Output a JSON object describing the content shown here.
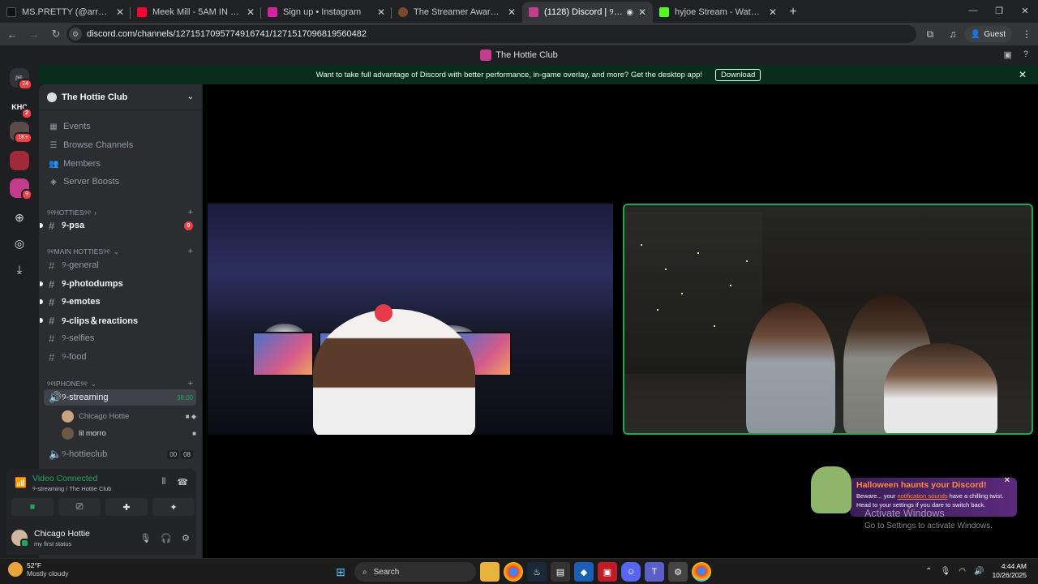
{
  "browser": {
    "tabs": [
      {
        "title": "MS.PRETTY (@arrogantdoll) | T",
        "color": "#111111",
        "active": false
      },
      {
        "title": "Meek Mill - 5AM IN PHILLY (Of",
        "color": "#ff0033",
        "active": false
      },
      {
        "title": "Sign up • Instagram",
        "color": "#d6249f",
        "active": false
      },
      {
        "title": "The Streamer Awards - Nomina",
        "color": "#7a4a2c",
        "active": false
      },
      {
        "title": "(1128) Discord | ୨-streamin",
        "color": "#c43d8c",
        "active": true
      },
      {
        "title": "hyjoe Stream - Watch Live on K",
        "color": "#53fc18",
        "active": false
      }
    ],
    "url": "discord.com/channels/1271517095774916741/1271517096819560482",
    "profile_label": "Guest"
  },
  "discord": {
    "window_title": "The Hottie Club",
    "server_badges": [
      "24",
      "2",
      "1K+",
      "9"
    ],
    "server_initials": "KHC",
    "banner": {
      "text": "Want to take full advantage of Discord with better performance, in-game overlay, and more? Get the desktop app!",
      "download_label": "Download"
    },
    "server_name": "The Hottie Club",
    "nav": [
      {
        "label": "Events"
      },
      {
        "label": "Browse Channels"
      },
      {
        "label": "Members"
      },
      {
        "label": "Server Boosts"
      }
    ],
    "categories": [
      "୨୧HOTTIES୨୧",
      "୨୧MAIN HOTTIES୨୧",
      "୨୧IPHONE୨୧"
    ],
    "channels_1": [
      {
        "name": "୨-psa",
        "badge": "9"
      }
    ],
    "channels_2": [
      {
        "name": "୨-general"
      },
      {
        "name": "୨-photodumps"
      },
      {
        "name": "୨-emotes"
      },
      {
        "name": "୨-clips＆reactions"
      },
      {
        "name": "୨-selfies"
      },
      {
        "name": "୨-food"
      }
    ],
    "voice_channel": {
      "name": "୨-streaming",
      "timer": "38:00"
    },
    "voice_users": [
      {
        "name": "Chicago Hottie"
      },
      {
        "name": "lil morro"
      }
    ],
    "voice_channel_2": {
      "name": "୨-hottieclub",
      "count_a": "00",
      "count_b": "08"
    },
    "voice_panel": {
      "status": "Video Connected",
      "location": "୨-streaming / The Hottie Club"
    },
    "user": {
      "name": "Chicago Hottie",
      "status": "my first status"
    },
    "toast": {
      "title": "Halloween haunts your Discord!",
      "text_before": "Beware... your ",
      "link": "notification sounds",
      "text_after": " have a chilling twist. Head to your settings if you dare to switch back."
    },
    "watermark_1": "Activate Windows",
    "watermark_2": "Go to Settings to activate Windows."
  },
  "taskbar": {
    "temp": "52°F",
    "weather": "Mostly cloudy",
    "search_label": "Search",
    "time": "4:44 AM",
    "date": "10/26/2025"
  }
}
